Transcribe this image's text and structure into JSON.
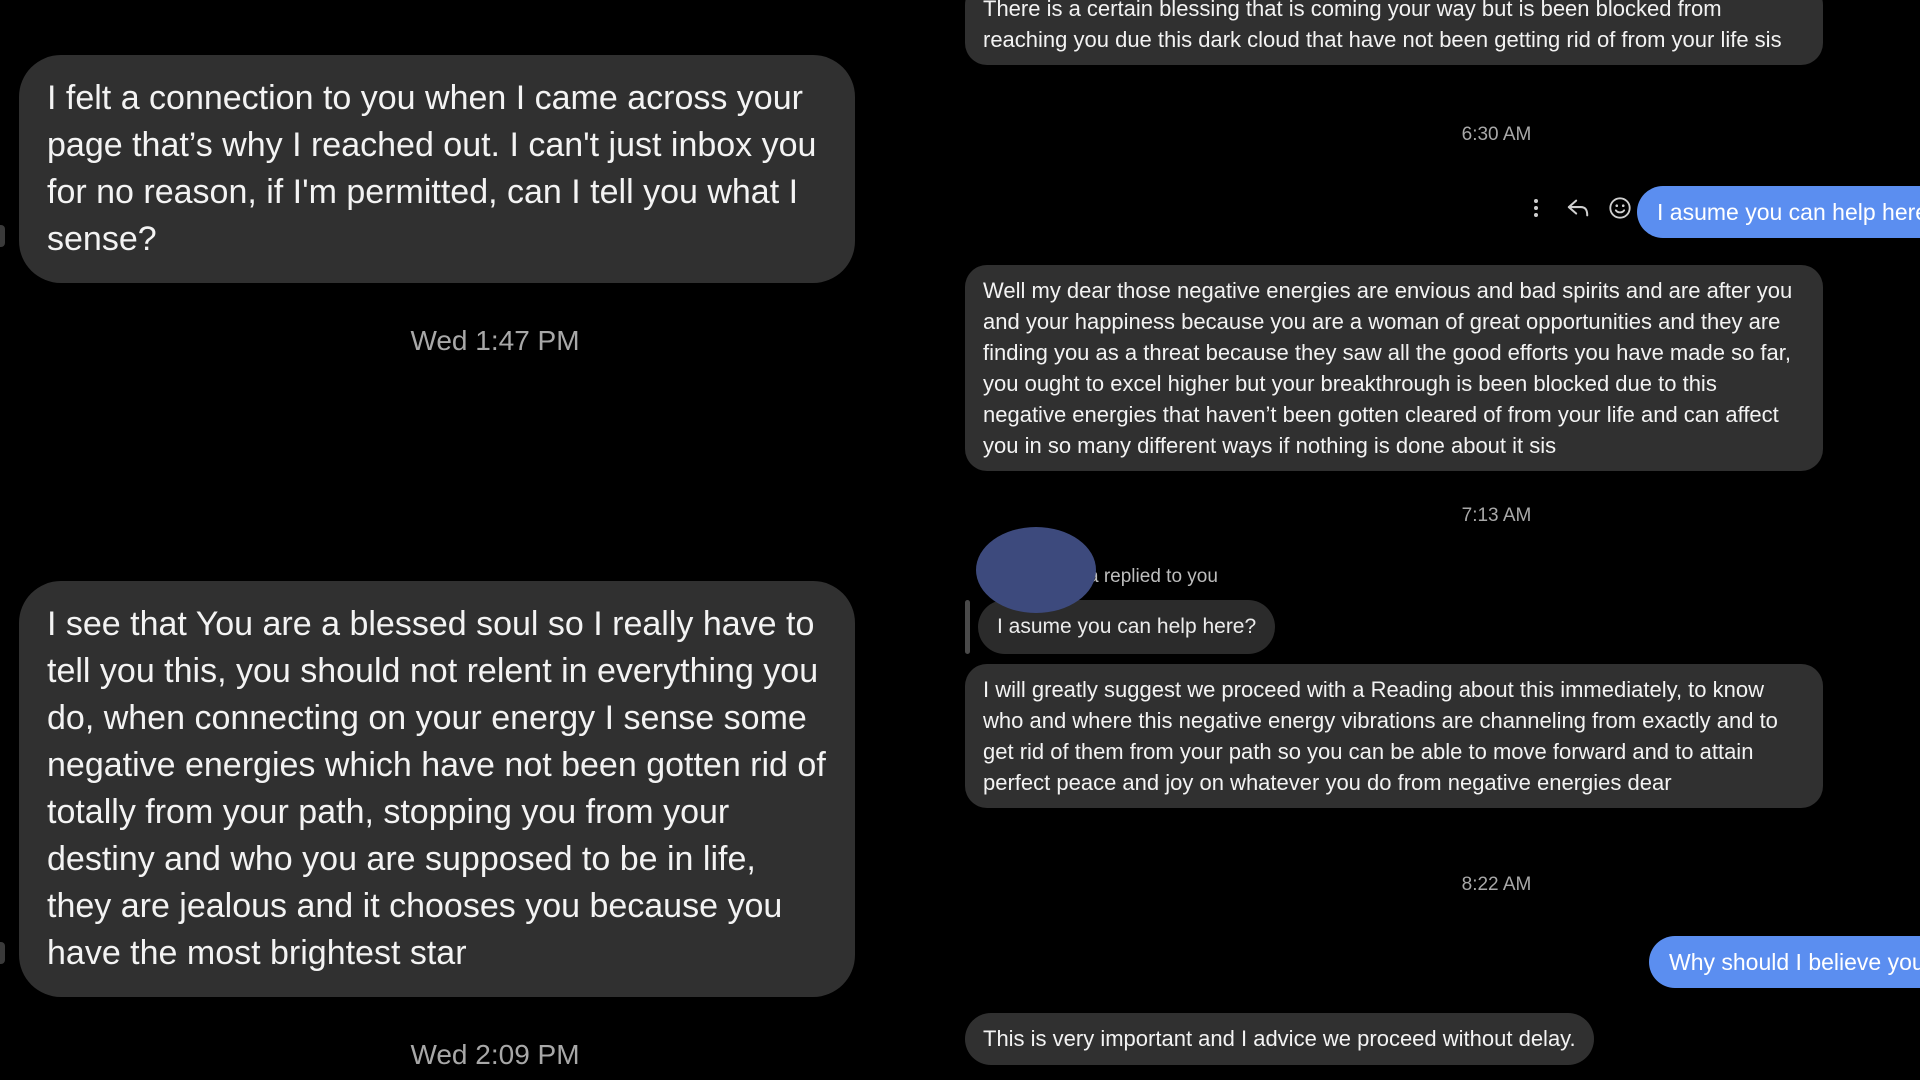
{
  "left_panel": {
    "messages": [
      {
        "text": "I felt a connection to you when I came across your page that’s why I reached out. I can't just inbox you for no reason, if I'm permitted, can I tell you what I sense?"
      },
      {
        "text": "I see that You are a blessed soul so I really have to tell you this, you should not relent in everything you do, when connecting on your energy I sense some negative energies which have not been gotten rid of totally from your path, stopping you from your destiny and who you are supposed to be in life, they are jealous and it chooses you because you have the most brightest star"
      }
    ],
    "timestamps": [
      "Wed 1:47 PM",
      "Wed 2:09 PM"
    ]
  },
  "right_panel": {
    "message_top": "There is a certain blessing that is coming your way but is been blocked from reaching you due this dark cloud that have not been getting  rid of from your life sis",
    "timestamp_1": "6:30 AM",
    "outgoing_1": "I asume you can help here?",
    "actions": [
      "more-icon",
      "reply-icon",
      "react-icon"
    ],
    "message_2": "Well my dear those negative energies are envious and bad spirits and are after you and your happiness because you are a woman of great opportunities and they are finding you as a threat because they saw all the good efforts you have made so far, you ought to excel higher but your breakthrough is been blocked due to this negative energies that haven’t been gotten cleared of from your life and can affect you in so many different ways if nothing is done about it sis",
    "timestamp_2": "7:13 AM",
    "reply": {
      "label": "a replied to you",
      "quoted": "I asume you can help here?"
    },
    "message_3": "I will greatly suggest we proceed with a Reading about this immediately, to know who and where this negative energy vibrations are channeling from exactly and to get rid of them from your path so you can be able to move forward and to attain perfect peace and joy on whatever you do from negative energies dear",
    "timestamp_3": "8:22 AM",
    "outgoing_2": "Why should I believe you?",
    "message_4": "This is very important and I advice we proceed without delay."
  },
  "colors": {
    "background": "#000000",
    "incoming_bubble": "#303030",
    "outgoing_bubble": "#5b8ef0",
    "timestamp_text": "#a8a8a8",
    "avatar_cover": "#3d4a7d"
  }
}
